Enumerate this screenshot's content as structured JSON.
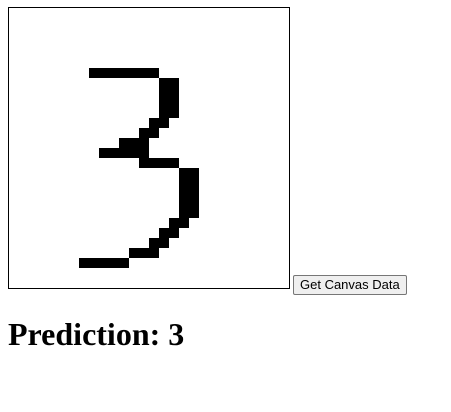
{
  "canvas": {
    "grid_size": 28,
    "stroke_color": "#000000",
    "background_color": "#ffffff",
    "filled_cells": [
      [
        8,
        6
      ],
      [
        9,
        6
      ],
      [
        10,
        6
      ],
      [
        11,
        6
      ],
      [
        12,
        6
      ],
      [
        13,
        6
      ],
      [
        14,
        6
      ],
      [
        15,
        7
      ],
      [
        16,
        7
      ],
      [
        15,
        8
      ],
      [
        16,
        8
      ],
      [
        15,
        9
      ],
      [
        16,
        9
      ],
      [
        15,
        10
      ],
      [
        16,
        10
      ],
      [
        14,
        11
      ],
      [
        15,
        11
      ],
      [
        13,
        12
      ],
      [
        14,
        12
      ],
      [
        11,
        13
      ],
      [
        12,
        13
      ],
      [
        13,
        13
      ],
      [
        9,
        14
      ],
      [
        10,
        14
      ],
      [
        11,
        14
      ],
      [
        12,
        14
      ],
      [
        13,
        14
      ],
      [
        13,
        15
      ],
      [
        14,
        15
      ],
      [
        15,
        15
      ],
      [
        16,
        15
      ],
      [
        17,
        16
      ],
      [
        18,
        16
      ],
      [
        17,
        17
      ],
      [
        18,
        17
      ],
      [
        17,
        18
      ],
      [
        18,
        18
      ],
      [
        17,
        19
      ],
      [
        18,
        19
      ],
      [
        17,
        20
      ],
      [
        18,
        20
      ],
      [
        16,
        21
      ],
      [
        17,
        21
      ],
      [
        15,
        22
      ],
      [
        16,
        22
      ],
      [
        14,
        23
      ],
      [
        15,
        23
      ],
      [
        12,
        24
      ],
      [
        13,
        24
      ],
      [
        14,
        24
      ],
      [
        7,
        25
      ],
      [
        8,
        25
      ],
      [
        9,
        25
      ],
      [
        10,
        25
      ],
      [
        11,
        25
      ]
    ]
  },
  "controls": {
    "get_data_label": "Get Canvas Data"
  },
  "result": {
    "prediction_text": "Prediction: 3"
  }
}
